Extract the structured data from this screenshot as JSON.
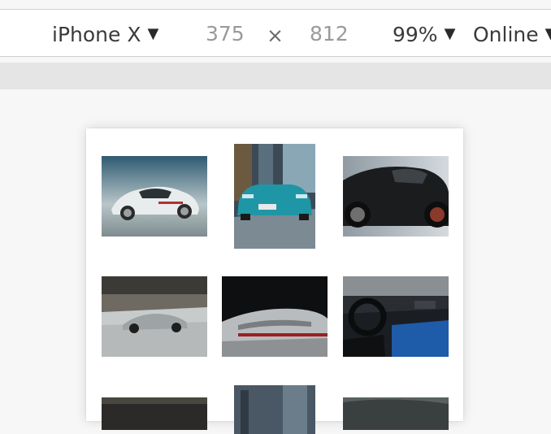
{
  "toolbar": {
    "device": "iPhone X",
    "width": "375",
    "times": "×",
    "height": "812",
    "zoom": "99%",
    "throttling": "Online"
  },
  "icons": {
    "dropdown": "chevron-down-icon",
    "multiply": "times-icon"
  },
  "gallery": {
    "images": [
      "white-porsche-cayman-rear",
      "teal-porsche-cayman-front",
      "black-porsche-cayman-side",
      "silver-porsche-911-side",
      "porsche-911-rear-spoiler",
      "porsche-911-interior",
      "partial-car-image-1",
      "partial-car-image-2",
      "partial-car-image-3"
    ]
  }
}
